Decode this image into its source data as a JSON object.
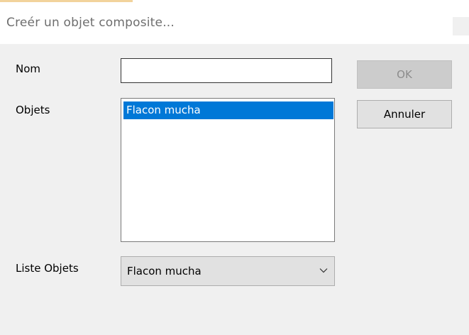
{
  "window": {
    "title": "Creér un objet composite..."
  },
  "form": {
    "nom_label": "Nom",
    "nom_value": "",
    "objets_label": "Objets",
    "objets_items": [
      "Flacon mucha"
    ],
    "liste_label": "Liste Objets",
    "liste_value": "Flacon mucha"
  },
  "buttons": {
    "ok": "OK",
    "cancel": "Annuler"
  },
  "colors": {
    "selection": "#0078d7",
    "title_accent": "#f2d39c"
  }
}
